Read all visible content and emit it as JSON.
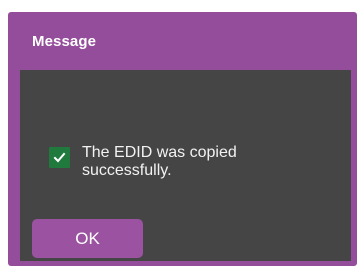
{
  "dialog": {
    "title": "Message",
    "message": "The EDID was copied successfully.",
    "ok_label": "OK",
    "status_icon": "check-icon"
  },
  "colors": {
    "title_bar": "#944d9a",
    "body_background": "#454545",
    "button": "#9b52a1",
    "success_check": "#207a3e",
    "text": "#ffffff"
  }
}
